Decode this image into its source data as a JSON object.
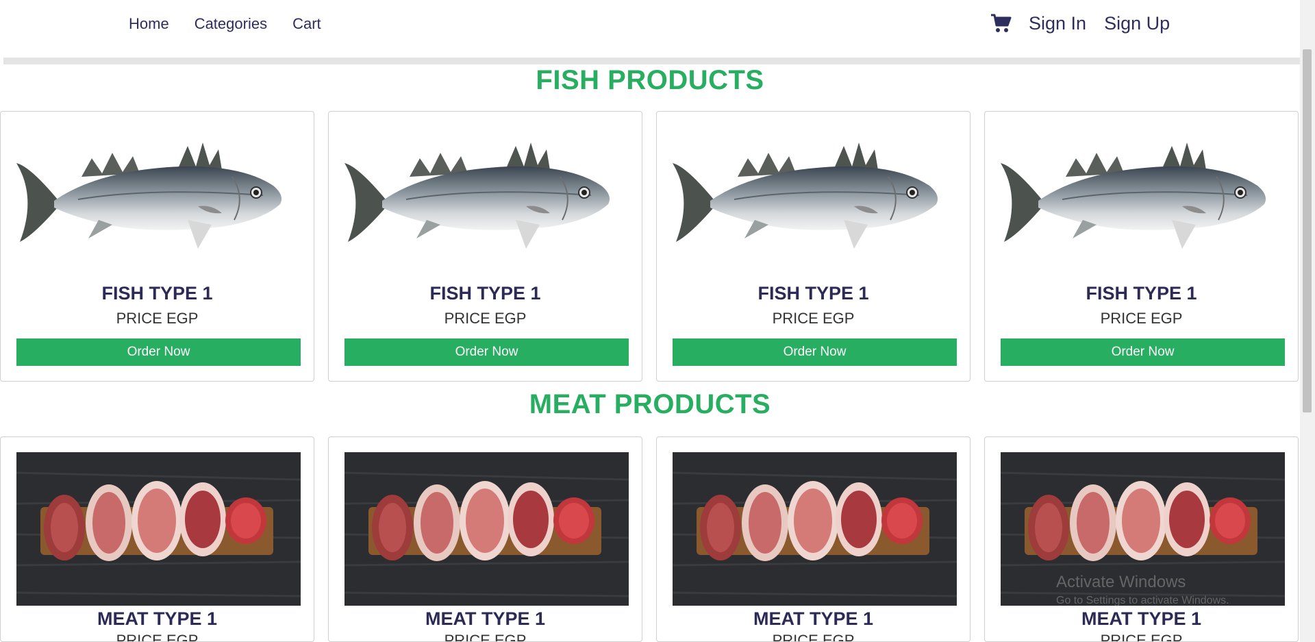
{
  "nav": {
    "home": "Home",
    "categories": "Categories",
    "cart": "Cart",
    "sign_in": "Sign In",
    "sign_up": "Sign Up",
    "cart_icon": "shopping-cart-icon"
  },
  "sections": {
    "fish": {
      "title": "FISH PRODUCTS",
      "products": [
        {
          "name": "FISH TYPE 1",
          "price": "PRICE EGP",
          "button": "Order Now"
        },
        {
          "name": "FISH TYPE 1",
          "price": "PRICE EGP",
          "button": "Order Now"
        },
        {
          "name": "FISH TYPE 1",
          "price": "PRICE EGP",
          "button": "Order Now"
        },
        {
          "name": "FISH TYPE 1",
          "price": "PRICE EGP",
          "button": "Order Now"
        }
      ]
    },
    "meat": {
      "title": "MEAT PRODUCTS",
      "products": [
        {
          "name": "MEAT TYPE 1",
          "price": "PRICE EGP"
        },
        {
          "name": "MEAT TYPE 1",
          "price": "PRICE EGP"
        },
        {
          "name": "MEAT TYPE 1",
          "price": "PRICE EGP"
        },
        {
          "name": "MEAT TYPE 1",
          "price": "PRICE EGP"
        }
      ]
    }
  },
  "watermark": {
    "title": "Activate Windows",
    "subtitle": "Go to Settings to activate Windows."
  },
  "colors": {
    "accent_green": "#27ae60",
    "navy_text": "#2b2b55"
  }
}
